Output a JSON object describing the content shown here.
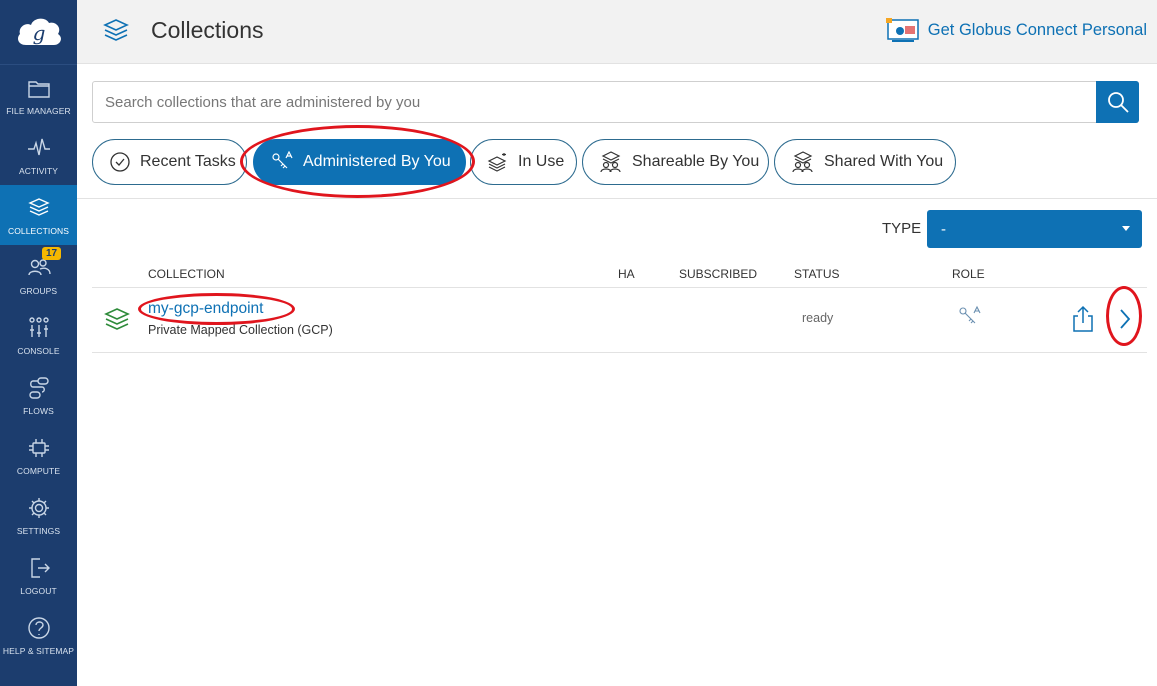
{
  "sidebar": {
    "items": [
      {
        "label": "FILE MANAGER",
        "icon": "folder-icon"
      },
      {
        "label": "ACTIVITY",
        "icon": "activity-icon"
      },
      {
        "label": "COLLECTIONS",
        "icon": "collections-icon",
        "active": true
      },
      {
        "label": "GROUPS",
        "icon": "groups-icon",
        "badge": "17"
      },
      {
        "label": "CONSOLE",
        "icon": "console-icon"
      },
      {
        "label": "FLOWS",
        "icon": "flows-icon"
      },
      {
        "label": "COMPUTE",
        "icon": "compute-icon"
      },
      {
        "label": "SETTINGS",
        "icon": "gear-icon"
      },
      {
        "label": "LOGOUT",
        "icon": "logout-icon"
      },
      {
        "label": "HELP & SITEMAP",
        "icon": "help-icon"
      }
    ]
  },
  "header": {
    "title": "Collections",
    "gcp_link": "Get Globus Connect Personal"
  },
  "search": {
    "placeholder": "Search collections that are administered by you"
  },
  "tabs": [
    {
      "label": "Recent Tasks",
      "icon": "clock-icon"
    },
    {
      "label": "Administered By You",
      "icon": "keys-icon",
      "active": true
    },
    {
      "label": "In Use",
      "icon": "in-use-icon"
    },
    {
      "label": "Shareable By You",
      "icon": "shareable-icon"
    },
    {
      "label": "Shared With You",
      "icon": "shared-icon"
    }
  ],
  "type_filter": {
    "label": "TYPE",
    "value": "-"
  },
  "table": {
    "headers": {
      "collection": "COLLECTION",
      "ha": "HA",
      "subscribed": "SUBSCRIBED",
      "status": "STATUS",
      "role": "ROLE"
    },
    "rows": [
      {
        "name": "my-gcp-endpoint",
        "description": "Private Mapped Collection (GCP)",
        "status": "ready",
        "role_icon": "keys-icon"
      }
    ]
  },
  "colors": {
    "sidebar": "#1c3d6e",
    "accent": "#0e71b4",
    "annotation": "#e0151d"
  }
}
